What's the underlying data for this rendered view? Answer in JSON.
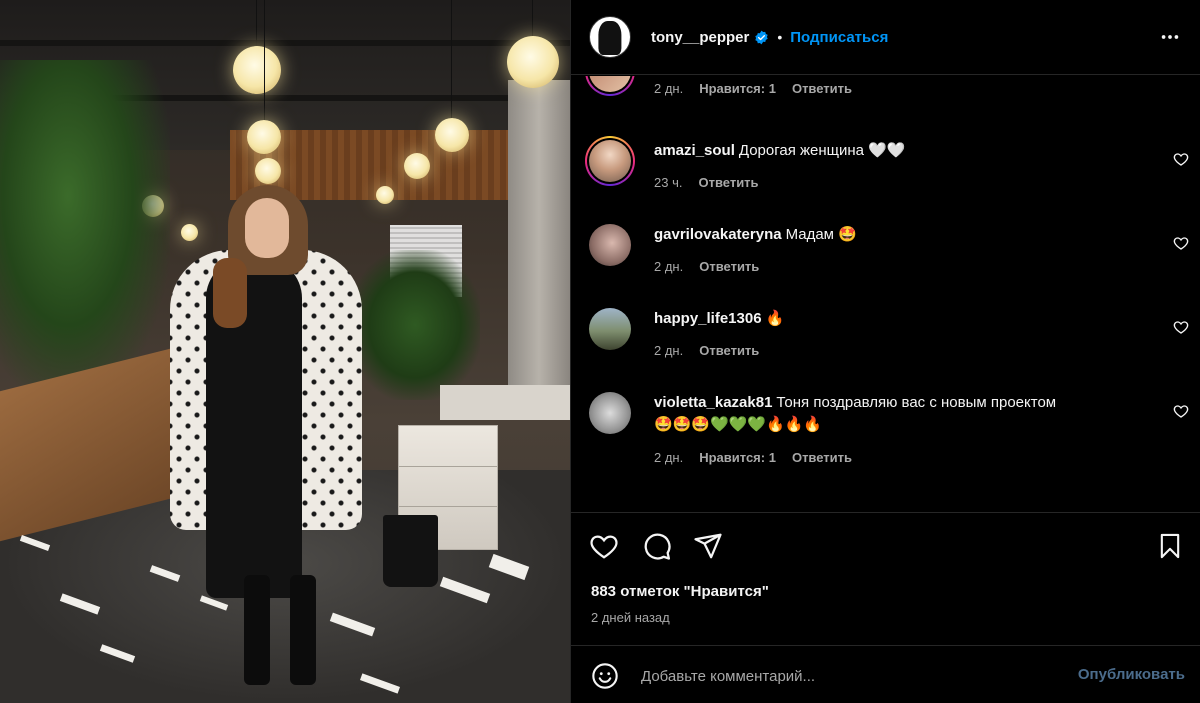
{
  "post": {
    "username": "tony__pepper",
    "verified": true,
    "dot": "•",
    "follow_label": "Подписаться",
    "more_icon": "more-horizontal-icon"
  },
  "comments": [
    {
      "username": "",
      "text": "",
      "time": "2 дн.",
      "likes": "Нравится: 1",
      "reply": "Ответить",
      "story_ring": true
    },
    {
      "username": "amazi_soul",
      "text": "Дорогая женщина 🤍🤍",
      "time": "23 ч.",
      "likes": "",
      "reply": "Ответить",
      "story_ring": true
    },
    {
      "username": "gavrilovakateryna",
      "text": "Мадам 🤩",
      "time": "2 дн.",
      "likes": "",
      "reply": "Ответить",
      "story_ring": false
    },
    {
      "username": "happy_life1306",
      "text": "🔥",
      "time": "2 дн.",
      "likes": "",
      "reply": "Ответить",
      "story_ring": false
    },
    {
      "username": "violetta_kazak81",
      "text": "Тоня поздравляю вас с новым проектом",
      "text2": "🤩🤩🤩💚💚💚🔥🔥🔥",
      "time": "2 дн.",
      "likes": "Нравится: 1",
      "reply": "Ответить",
      "story_ring": false
    }
  ],
  "actions": {
    "like_icon": "heart-icon",
    "comment_icon": "comment-bubble-icon",
    "share_icon": "paper-plane-icon",
    "save_icon": "bookmark-icon",
    "likes_count": "883 отметок \"Нравится\"",
    "time_ago": "2 дней назад"
  },
  "comment_box": {
    "emoji_icon": "smiley-icon",
    "placeholder": "Добавьте комментарий...",
    "publish_label": "Опубликовать"
  },
  "colors": {
    "background": "#000000",
    "accent": "#0095f6",
    "muted_text": "#a8a8a8",
    "publish_disabled": "#4b6c8c",
    "divider": "#262626"
  }
}
